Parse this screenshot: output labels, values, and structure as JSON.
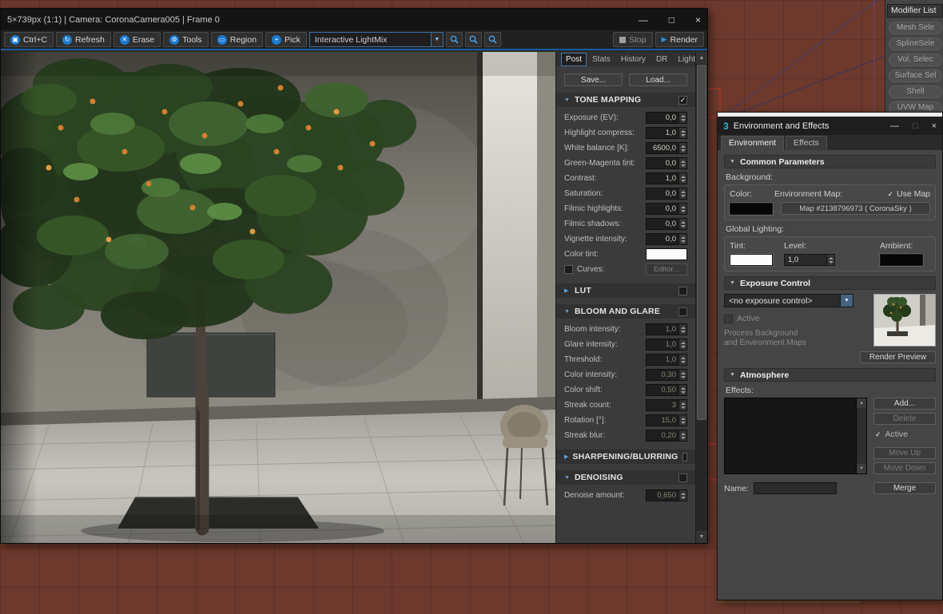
{
  "colors": {
    "accent_blue": "#1d7ad0",
    "toolbar_underline": "#17599c",
    "viewport_maroon": "#6d392c",
    "panel_gray": "#454545",
    "selection_red": "#b23b28"
  },
  "icons": {
    "check": "✓",
    "down": "▼",
    "right": "▶",
    "play": "▶",
    "minimize": "—",
    "maximize": "□",
    "close": "×",
    "up_arrow": "▲",
    "down_arrow": "▼",
    "copy": "▣",
    "refresh": "↻",
    "erase": "✕",
    "tools": "⚙",
    "region": "▭",
    "pick": "+"
  },
  "viewport": {
    "modifier_list": "Modifier List",
    "modifier_buttons": [
      "Mesh Sele",
      "SplineSele",
      "Vol. Selec",
      "Surface Sel",
      "Shell",
      "UVW Map"
    ]
  },
  "vfb": {
    "title": "5×739px (1:1) | Camera: CoronaCamera005 | Frame 0",
    "toolbar": {
      "copy": "Ctrl+C",
      "refresh": "Refresh",
      "erase": "Erase",
      "tools": "Tools",
      "region": "Region",
      "pick": "Pick",
      "mode_dropdown": "Interactive LightMix",
      "stop": "Stop",
      "render": "Render"
    },
    "tabs": [
      {
        "label": "Post"
      },
      {
        "label": "Stats"
      },
      {
        "label": "History"
      },
      {
        "label": "DR"
      },
      {
        "label": "LightMix"
      }
    ],
    "save": "Save...",
    "load": "Load...",
    "tone_mapping": {
      "title": "TONE MAPPING",
      "rows": [
        {
          "label": "Exposure (EV):",
          "value": "0,0"
        },
        {
          "label": "Highlight compress:",
          "value": "1,0"
        },
        {
          "label": "White balance [K]:",
          "value": "6500,0"
        },
        {
          "label": "Green-Magenta tint:",
          "value": "0,0"
        },
        {
          "label": "Contrast:",
          "value": "1,0"
        },
        {
          "label": "Saturation:",
          "value": "0,0"
        },
        {
          "label": "Filmic highlights:",
          "value": "0,0"
        },
        {
          "label": "Filmic shadows:",
          "value": "0,0"
        },
        {
          "label": "Vignette intensity:",
          "value": "0,0"
        }
      ],
      "color_tint_label": "Color tint:",
      "curves_label": "Curves:",
      "editor_button": "Editor..."
    },
    "lut": {
      "title": "LUT"
    },
    "bloom_glare": {
      "title": "BLOOM AND GLARE",
      "rows": [
        {
          "label": "Bloom intensity:",
          "value": "1,0"
        },
        {
          "label": "Glare intensity:",
          "value": "1,0"
        },
        {
          "label": "Threshold:",
          "value": "1,0"
        },
        {
          "label": "Color intensity:",
          "value": "0,30"
        },
        {
          "label": "Color shift:",
          "value": "0,50"
        },
        {
          "label": "Streak count:",
          "value": "3"
        },
        {
          "label": "Rotation [°]:",
          "value": "15,0"
        },
        {
          "label": "Streak blur:",
          "value": "0,20"
        }
      ]
    },
    "sharpening": {
      "title": "SHARPENING/BLURRING"
    },
    "denoising": {
      "title": "DENOISING",
      "rows": [
        {
          "label": "Denoise amount:",
          "value": "0,650"
        }
      ]
    }
  },
  "env_dialog": {
    "logo": "3",
    "title": "Environment and Effects",
    "tabs": [
      {
        "label": "Environment"
      },
      {
        "label": "Effects"
      }
    ],
    "common_parameters": {
      "title": "Common Parameters",
      "background_label": "Background:",
      "color_label": "Color:",
      "env_map_label": "Environment Map:",
      "use_map_label": "Use Map",
      "map_button": "Map #2138796973  ( CoronaSky )",
      "global_lighting_label": "Global Lighting:",
      "tint_label": "Tint:",
      "level_label": "Level:",
      "level_value": "1,0",
      "ambient_label": "Ambient:"
    },
    "exposure_control": {
      "title": "Exposure Control",
      "dropdown_value": "<no exposure control>",
      "active_label": "Active",
      "process_line1": "Process Background",
      "process_line2": "and Environment Maps",
      "render_preview": "Render Preview"
    },
    "atmosphere": {
      "title": "Atmosphere",
      "effects_label": "Effects:",
      "add": "Add...",
      "delete": "Delete",
      "active": "Active",
      "move_up": "Move Up",
      "move_down": "Move Down",
      "name_label": "Name:",
      "merge": "Merge"
    }
  }
}
